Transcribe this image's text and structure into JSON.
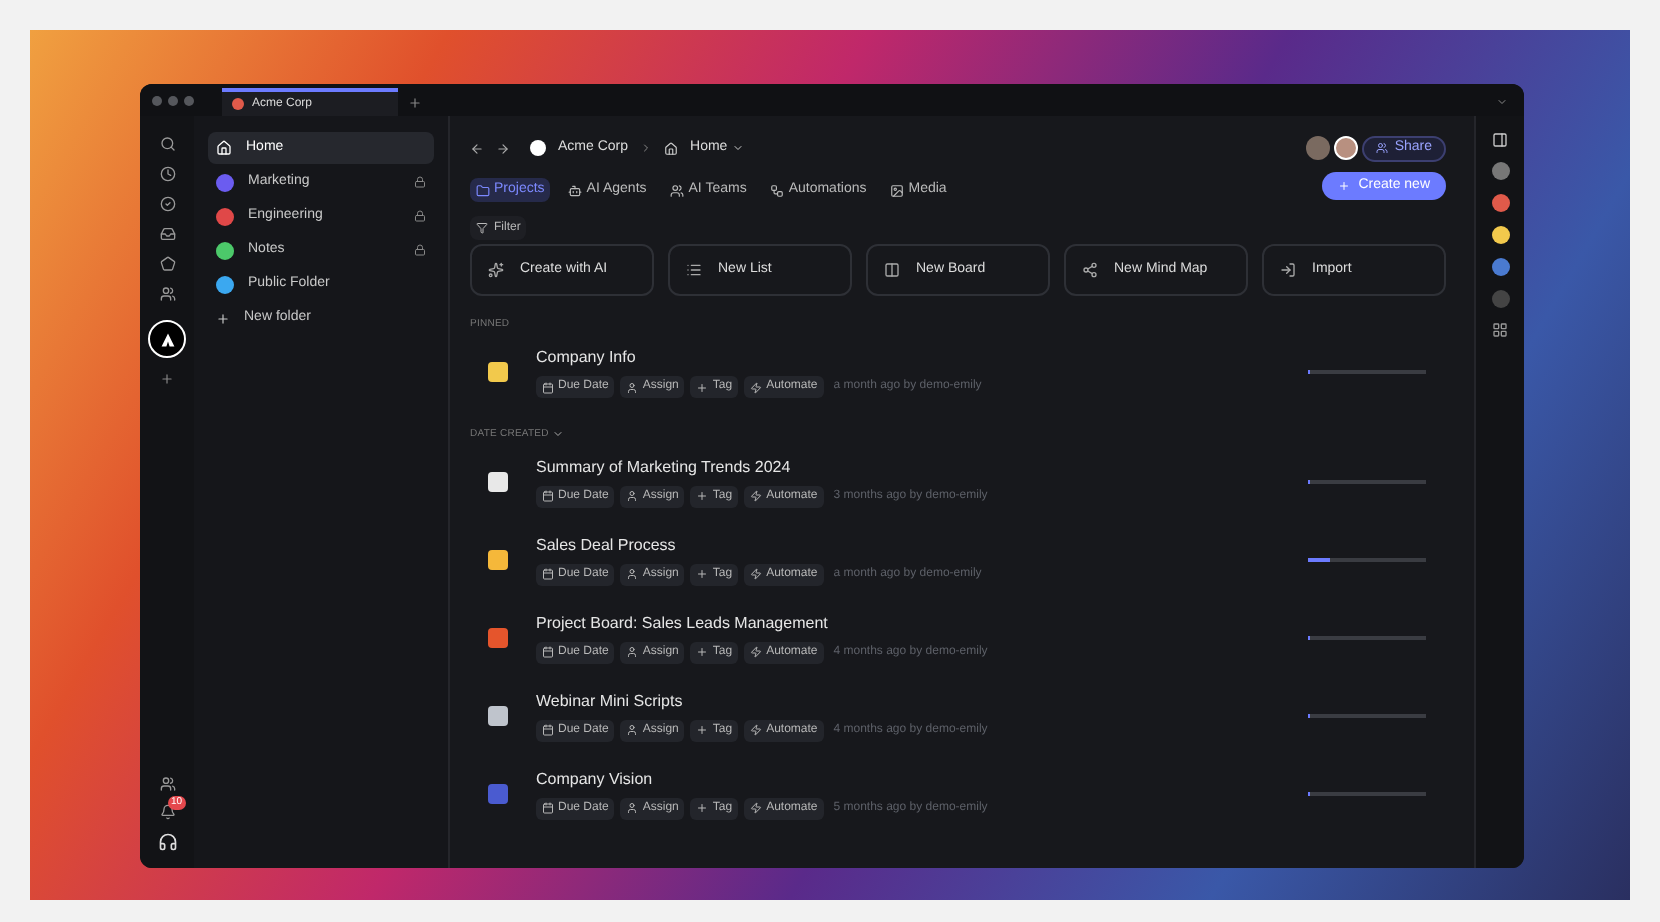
{
  "window": {
    "tab_title": "Acme Corp"
  },
  "sidebar": {
    "items": [
      {
        "label": "Home",
        "selected": true,
        "locked": false,
        "kind": "home"
      },
      {
        "label": "Marketing",
        "selected": false,
        "locked": true,
        "kind": "folder",
        "color": "#6b5cf0"
      },
      {
        "label": "Engineering",
        "selected": false,
        "locked": true,
        "kind": "folder",
        "color": "#e04848"
      },
      {
        "label": "Notes",
        "selected": false,
        "locked": true,
        "kind": "folder",
        "color": "#4cc96a"
      },
      {
        "label": "Public Folder",
        "selected": false,
        "locked": false,
        "kind": "folder",
        "color": "#3ba8f0"
      },
      {
        "label": "New folder",
        "selected": false,
        "locked": false,
        "kind": "add"
      }
    ]
  },
  "notification_badge": "10",
  "breadcrumb": {
    "workspace": "Acme Corp",
    "page": "Home"
  },
  "share_button": "Share",
  "create_button": "Create new",
  "tabs": [
    {
      "label": "Projects",
      "selected": true
    },
    {
      "label": "AI Agents",
      "selected": false
    },
    {
      "label": "AI Teams",
      "selected": false
    },
    {
      "label": "Automations",
      "selected": false
    },
    {
      "label": "Media",
      "selected": false
    }
  ],
  "filter_button": "Filter",
  "quick_actions": [
    "Create with AI",
    "New List",
    "New Board",
    "New Mind Map",
    "Import"
  ],
  "sections": [
    {
      "heading": "PINNED",
      "collapsible": false,
      "items": [
        {
          "title": "Company Info",
          "meta": "a month ago by demo-emily",
          "level": 0,
          "color": "#f2c94c",
          "actions": [
            "Due Date",
            "Assign",
            "Tag",
            "Automate"
          ]
        }
      ]
    },
    {
      "heading": "DATE CREATED",
      "collapsible": true,
      "items": [
        {
          "title": "Summary of Marketing Trends 2024",
          "meta": "3 months ago by demo-emily",
          "level": 0,
          "color": "#e8e8e8",
          "actions": [
            "Due Date",
            "Assign",
            "Tag",
            "Automate"
          ]
        },
        {
          "title": "Sales Deal Process",
          "meta": "a month ago by demo-emily",
          "level": 0.18,
          "color": "#f5b83a",
          "actions": [
            "Due Date",
            "Assign",
            "Tag",
            "Automate"
          ]
        },
        {
          "title": "Project Board: Sales Leads Management",
          "meta": "4 months ago by demo-emily",
          "level": 0,
          "color": "#e5552c",
          "actions": [
            "Due Date",
            "Assign",
            "Tag",
            "Automate"
          ]
        },
        {
          "title": "Webinar Mini Scripts",
          "meta": "4 months ago by demo-emily",
          "level": 0,
          "color": "#bfc4cc",
          "actions": [
            "Due Date",
            "Assign",
            "Tag",
            "Automate"
          ]
        },
        {
          "title": "Company Vision",
          "meta": "5 months ago by demo-emily",
          "level": 0,
          "color": "#4a5bd0",
          "actions": [
            "Due Date",
            "Assign",
            "Tag",
            "Automate"
          ]
        }
      ]
    }
  ]
}
